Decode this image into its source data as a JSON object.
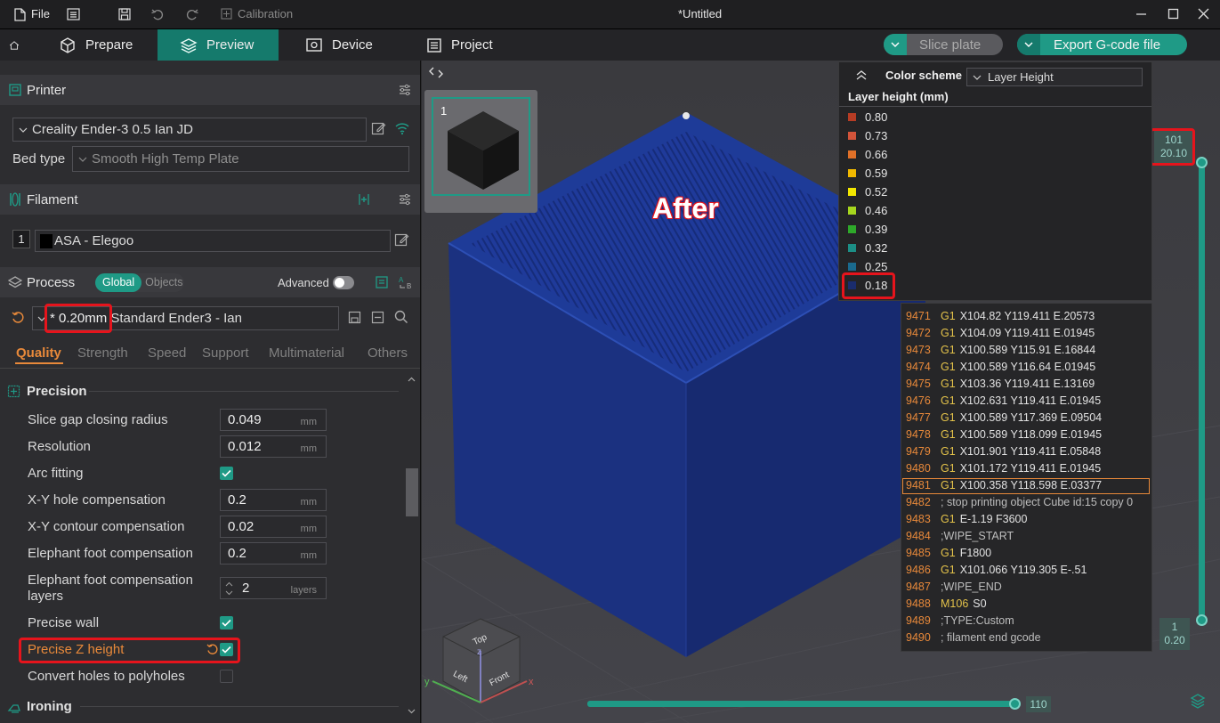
{
  "titlebar": {
    "file": "File",
    "calibration": "Calibration",
    "title": "*Untitled"
  },
  "tabs": {
    "prepare": "Prepare",
    "preview": "Preview",
    "device": "Device",
    "project": "Project"
  },
  "actions": {
    "slice": "Slice plate",
    "export": "Export G-code file"
  },
  "printer": {
    "section": "Printer",
    "name": "Creality Ender-3 0.5 Ian JD",
    "bed_label": "Bed type",
    "bed_value": "Smooth High Temp Plate"
  },
  "filament": {
    "section": "Filament",
    "index": "1",
    "name": "ASA - Elegoo"
  },
  "process": {
    "section": "Process",
    "global": "Global",
    "objects": "Objects",
    "advanced": "Advanced",
    "preset_highlight": "* 0.20mm",
    "preset_rest": " Standard Ender3 - Ian"
  },
  "subtabs": [
    "Quality",
    "Strength",
    "Speed",
    "Support",
    "Multimaterial",
    "Others"
  ],
  "precision": {
    "title": "Precision",
    "slice_gap_label": "Slice gap closing radius",
    "slice_gap_value": "0.049",
    "mm": "mm",
    "resolution_label": "Resolution",
    "resolution_value": "0.012",
    "arc_label": "Arc fitting",
    "xy_hole_label": "X-Y hole compensation",
    "xy_hole_value": "0.2",
    "xy_contour_label": "X-Y contour compensation",
    "xy_contour_value": "0.02",
    "elephant_label": "Elephant foot compensation",
    "elephant_value": "0.2",
    "elephant_layers_label1": "Elephant foot compensation",
    "elephant_layers_label2": "layers",
    "elephant_layers_value": "2",
    "layers_unit": "layers",
    "precise_wall_label": "Precise wall",
    "precise_z_label": "Precise Z height",
    "convert_holes_label": "Convert holes to polyholes"
  },
  "ironing": {
    "title": "Ironing"
  },
  "viewport": {
    "plate_number": "1",
    "annotation": "After",
    "color_scheme_label": "Color scheme",
    "color_scheme_value": "Layer Height",
    "legend_title": "Layer height (mm)",
    "legend": [
      {
        "value": "0.80",
        "color": "#b63c24"
      },
      {
        "value": "0.73",
        "color": "#d3543a"
      },
      {
        "value": "0.66",
        "color": "#e07028"
      },
      {
        "value": "0.59",
        "color": "#f0b800"
      },
      {
        "value": "0.52",
        "color": "#f2e600"
      },
      {
        "value": "0.46",
        "color": "#a6d61e"
      },
      {
        "value": "0.39",
        "color": "#2ea82a"
      },
      {
        "value": "0.32",
        "color": "#1c8e86"
      },
      {
        "value": "0.25",
        "color": "#1a6a8e"
      },
      {
        "value": "0.18",
        "color": "#1a2c6e"
      }
    ],
    "top_slider": {
      "layer": "101",
      "height": "20.10"
    },
    "bottom_slider": {
      "layer": "1",
      "height": "0.20"
    },
    "h_slider_value": "110",
    "gcode": [
      {
        "n": "9471",
        "cmd": "G1",
        "args": "X104.82 Y119.411 E.20573"
      },
      {
        "n": "9472",
        "cmd": "G1",
        "args": "X104.09 Y119.411 E.01945"
      },
      {
        "n": "9473",
        "cmd": "G1",
        "args": "X100.589 Y115.91 E.16844"
      },
      {
        "n": "9474",
        "cmd": "G1",
        "args": "X100.589 Y116.64 E.01945"
      },
      {
        "n": "9475",
        "cmd": "G1",
        "args": "X103.36 Y119.411 E.13169"
      },
      {
        "n": "9476",
        "cmd": "G1",
        "args": "X102.631 Y119.411 E.01945"
      },
      {
        "n": "9477",
        "cmd": "G1",
        "args": "X100.589 Y117.369 E.09504"
      },
      {
        "n": "9478",
        "cmd": "G1",
        "args": "X100.589 Y118.099 E.01945"
      },
      {
        "n": "9479",
        "cmd": "G1",
        "args": "X101.901 Y119.411 E.05848"
      },
      {
        "n": "9480",
        "cmd": "G1",
        "args": "X101.172 Y119.411 E.01945"
      },
      {
        "n": "9481",
        "cmd": "G1",
        "args": "X100.358 Y118.598 E.03377"
      },
      {
        "n": "9482",
        "cmd": "",
        "args": "; stop printing object Cube id:15 copy 0"
      },
      {
        "n": "9483",
        "cmd": "G1",
        "args": "E-1.19 F3600"
      },
      {
        "n": "9484",
        "cmd": "",
        "args": ";WIPE_START"
      },
      {
        "n": "9485",
        "cmd": "G1",
        "args": "F1800"
      },
      {
        "n": "9486",
        "cmd": "G1",
        "args": "X101.066 Y119.305 E-.51"
      },
      {
        "n": "9487",
        "cmd": "",
        "args": ";WIPE_END"
      },
      {
        "n": "9488",
        "cmd": "M106",
        "args": "S0"
      },
      {
        "n": "9489",
        "cmd": "",
        "args": ";TYPE:Custom"
      },
      {
        "n": "9490",
        "cmd": "",
        "args": "; filament end gcode"
      }
    ],
    "cube_labels": {
      "top": "Top",
      "left": "Left",
      "front": "Front",
      "x": "x",
      "y": "y",
      "z": "z"
    }
  },
  "colors": {
    "accent": "#1f9a86",
    "active_tab": "#157a6c",
    "highlight_red": "#e6141c",
    "object_blue": "#1b3180",
    "orange": "#e8893a"
  }
}
